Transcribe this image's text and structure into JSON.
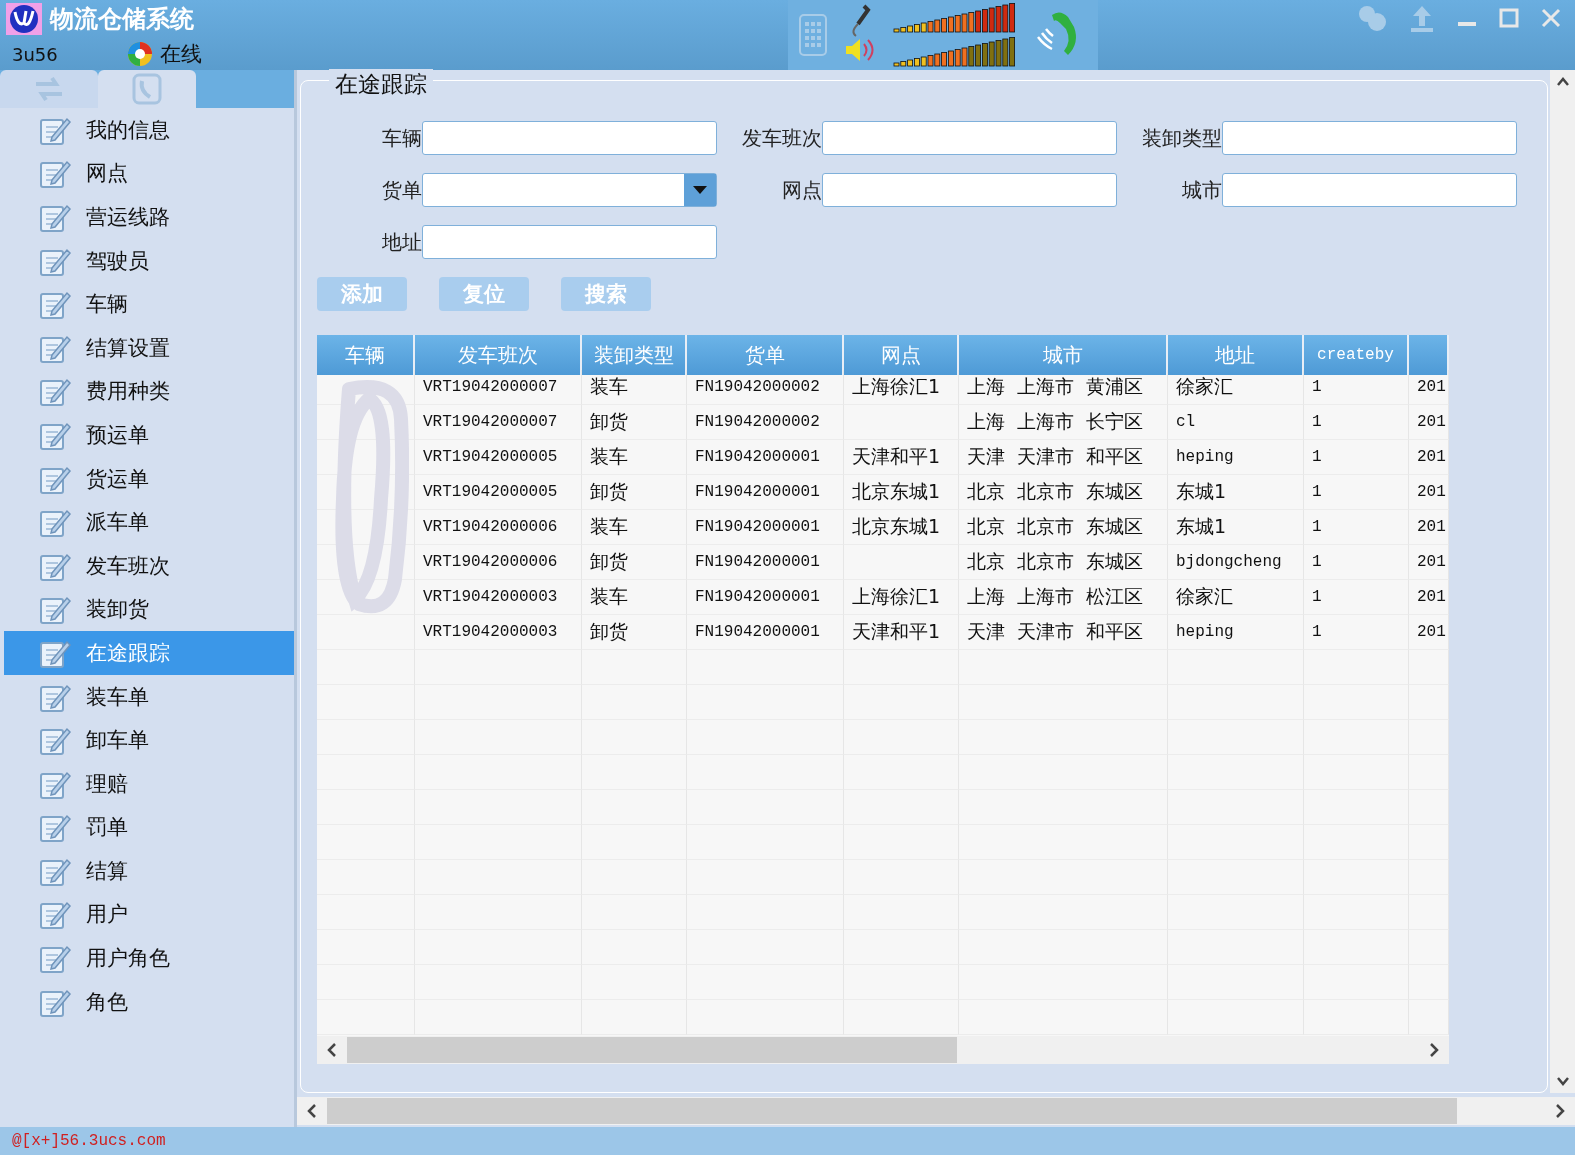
{
  "window": {
    "title": "物流仓储系统",
    "account": "3u56",
    "status": "在线"
  },
  "sidebar": {
    "items": [
      {
        "label": "我的信息",
        "selected": false
      },
      {
        "label": "网点",
        "selected": false
      },
      {
        "label": "营运线路",
        "selected": false
      },
      {
        "label": "驾驶员",
        "selected": false
      },
      {
        "label": "车辆",
        "selected": false
      },
      {
        "label": "结算设置",
        "selected": false
      },
      {
        "label": "费用种类",
        "selected": false
      },
      {
        "label": "预运单",
        "selected": false
      },
      {
        "label": "货运单",
        "selected": false
      },
      {
        "label": "派车单",
        "selected": false
      },
      {
        "label": "发车班次",
        "selected": false
      },
      {
        "label": "装卸货",
        "selected": false
      },
      {
        "label": "在途跟踪",
        "selected": true
      },
      {
        "label": "装车单",
        "selected": false
      },
      {
        "label": "卸车单",
        "selected": false
      },
      {
        "label": "理赔",
        "selected": false
      },
      {
        "label": "罚单",
        "selected": false
      },
      {
        "label": "结算",
        "selected": false
      },
      {
        "label": "用户",
        "selected": false
      },
      {
        "label": "用户角色",
        "selected": false
      },
      {
        "label": "角色",
        "selected": false
      }
    ]
  },
  "panel": {
    "title": "在途跟踪",
    "fields": [
      {
        "label": "车辆",
        "kind": "text"
      },
      {
        "label": "发车班次",
        "kind": "text"
      },
      {
        "label": "装卸类型",
        "kind": "text"
      },
      {
        "label": "货单",
        "kind": "dropdown"
      },
      {
        "label": "网点",
        "kind": "text"
      },
      {
        "label": "城市",
        "kind": "text"
      },
      {
        "label": "地址",
        "kind": "text"
      }
    ],
    "buttons": [
      "添加",
      "复位",
      "搜索"
    ],
    "table": {
      "columns": [
        "车辆",
        "发车班次",
        "装卸类型",
        "货单",
        "网点",
        "城市",
        "地址",
        "createby"
      ],
      "rows": [
        {
          "cells": [
            "",
            "VRT19042000007",
            "装车",
            "FN19042000002",
            "上海徐汇1",
            "上海 上海市 黄浦区",
            "徐家汇",
            "1",
            "201"
          ]
        },
        {
          "cells": [
            "",
            "VRT19042000007",
            "卸货",
            "FN19042000002",
            "",
            "上海 上海市 长宁区",
            "cl",
            "1",
            "201"
          ]
        },
        {
          "cells": [
            "",
            "VRT19042000005",
            "装车",
            "FN19042000001",
            "天津和平1",
            "天津 天津市 和平区",
            "heping",
            "1",
            "201"
          ]
        },
        {
          "cells": [
            "",
            "VRT19042000005",
            "卸货",
            "FN19042000001",
            "北京东城1",
            "北京 北京市 东城区",
            "东城1",
            "1",
            "201"
          ]
        },
        {
          "cells": [
            "",
            "VRT19042000006",
            "装车",
            "FN19042000001",
            "北京东城1",
            "北京 北京市 东城区",
            "东城1",
            "1",
            "201"
          ]
        },
        {
          "cells": [
            "",
            "VRT19042000006",
            "卸货",
            "FN19042000001",
            "",
            "北京 北京市 东城区",
            "bjdongcheng",
            "1",
            "201"
          ]
        },
        {
          "cells": [
            "",
            "VRT19042000003",
            "装车",
            "FN19042000001",
            "上海徐汇1",
            "上海 上海市 松江区",
            "徐家汇",
            "1",
            "201"
          ]
        },
        {
          "cells": [
            "",
            "VRT19042000003",
            "卸货",
            "FN19042000001",
            "天津和平1",
            "天津 天津市 和平区",
            "heping",
            "1",
            "201"
          ]
        }
      ]
    }
  },
  "status_bar": "@[x+]56.3ucs.com"
}
